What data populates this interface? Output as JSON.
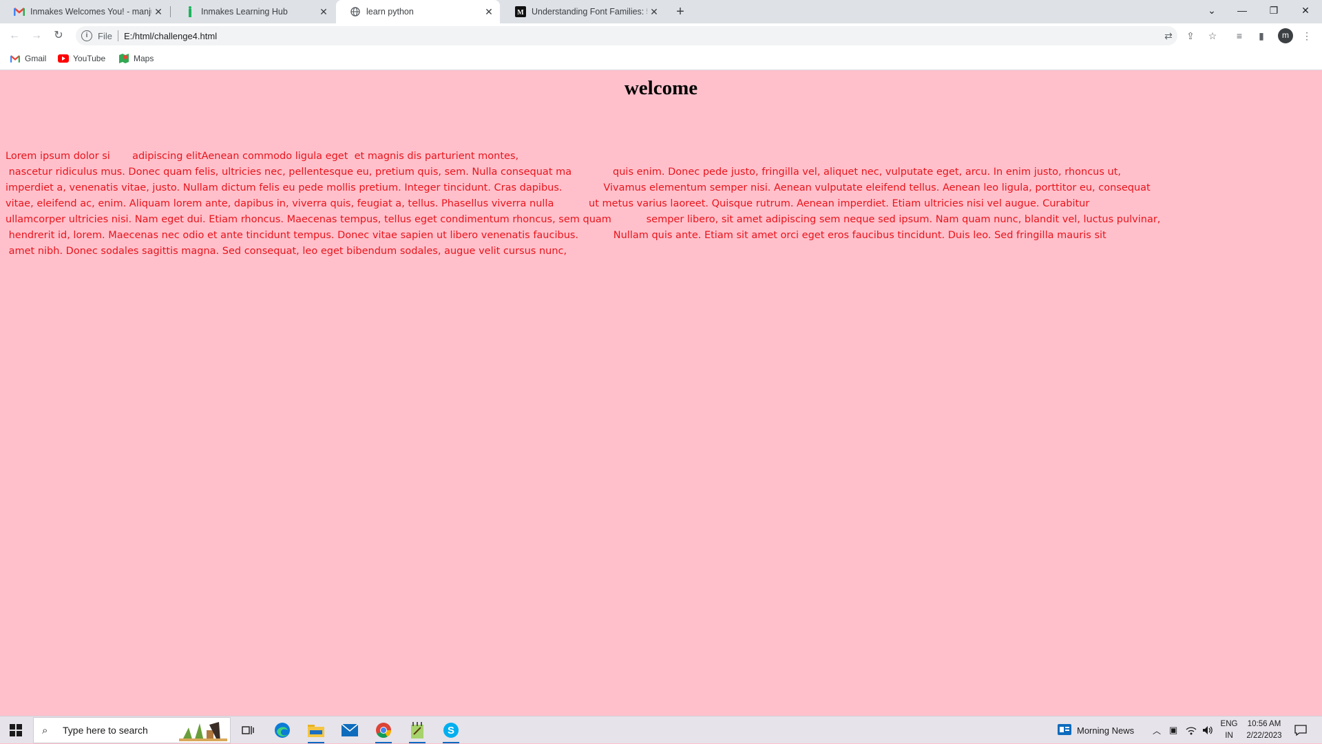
{
  "browser": {
    "tabs": [
      {
        "title": "Inmakes Welcomes You! - manjul",
        "icon": "gmail-icon",
        "active": false
      },
      {
        "title": "Inmakes Learning Hub",
        "icon": "inmakes-icon",
        "active": false
      },
      {
        "title": "learn python",
        "icon": "globe-icon",
        "active": true
      },
      {
        "title": "Understanding Font Families: 5 Ty",
        "icon": "medium-icon",
        "active": false
      }
    ],
    "address": {
      "scheme": "File",
      "url": "E:/html/challenge4.html"
    },
    "profile_initial": "m",
    "bookmarks": [
      {
        "label": "Gmail",
        "icon": "gmail-icon"
      },
      {
        "label": "YouTube",
        "icon": "youtube-icon"
      },
      {
        "label": "Maps",
        "icon": "maps-icon"
      }
    ]
  },
  "page": {
    "heading": "welcome",
    "paragraph_lines": [
      "Lorem ipsum dolor si       adipiscing elitAenean commodo ligula eget  et magnis dis parturient montes,",
      " nascetur ridiculus mus. Donec quam felis, ultricies nec, pellentesque eu, pretium quis, sem. Nulla consequat ma             quis enim. Donec pede justo, fringilla vel, aliquet nec, vulputate eget, arcu. In enim justo, rhoncus ut,",
      "imperdiet a, venenatis vitae, justo. Nullam dictum felis eu pede mollis pretium. Integer tincidunt. Cras dapibus.             Vivamus elementum semper nisi. Aenean vulputate eleifend tellus. Aenean leo ligula, porttitor eu, consequat",
      "vitae, eleifend ac, enim. Aliquam lorem ante, dapibus in, viverra quis, feugiat a, tellus. Phasellus viverra nulla           ut metus varius laoreet. Quisque rutrum. Aenean imperdiet. Etiam ultricies nisi vel augue. Curabitur",
      "ullamcorper ultricies nisi. Nam eget dui. Etiam rhoncus. Maecenas tempus, tellus eget condimentum rhoncus, sem quam           semper libero, sit amet adipiscing sem neque sed ipsum. Nam quam nunc, blandit vel, luctus pulvinar,",
      " hendrerit id, lorem. Maecenas nec odio et ante tincidunt tempus. Donec vitae sapien ut libero venenatis faucibus.           Nullam quis ante. Etiam sit amet orci eget eros faucibus tincidunt. Duis leo. Sed fringilla mauris sit",
      " amet nibh. Donec sodales sagittis magna. Sed consequat, leo eget bibendum sodales, augue velit cursus nunc,"
    ]
  },
  "taskbar": {
    "search_placeholder": "Type here to search",
    "news": "Morning News",
    "lang_top": "ENG",
    "lang_bottom": "IN",
    "time": "10:56 AM",
    "date": "2/22/2023"
  },
  "colors": {
    "page_bg": "#ffc0cb",
    "text": "#e8141c",
    "heading": "#000000"
  }
}
